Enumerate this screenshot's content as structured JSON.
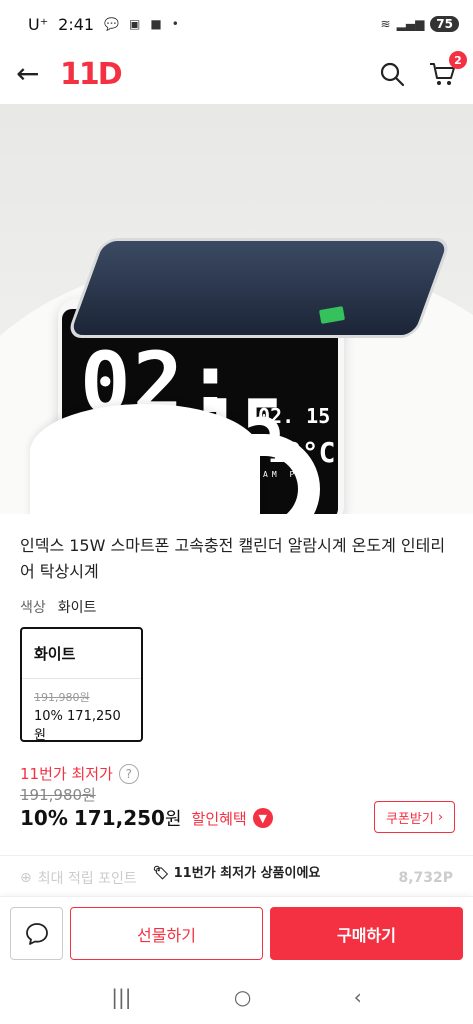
{
  "status_bar": {
    "carrier": "U⁺",
    "time": "2:41",
    "battery": "75"
  },
  "header": {
    "logo": "11D",
    "cart_count": "2"
  },
  "product": {
    "title": "인덱스 15W 스마트폰 고속충전 캘린더 알람시계 온도계 인테리어 탁상시계",
    "option_key": "색상",
    "option_value": "화이트",
    "option_card": {
      "name": "화이트",
      "original_price": "191,980원",
      "sale": "10% 171,250원"
    },
    "image_display": {
      "time_hours": "02:",
      "time_minutes": "15",
      "date": "02. 15",
      "temp": "19°C",
      "ampm": "AM PM"
    }
  },
  "pricing": {
    "lowest_label": "11번가 최저가",
    "original_price": "191,980원",
    "discount_pct": "10%",
    "price": "171,250",
    "currency": "원",
    "benefit_label": "할인혜택",
    "coupon_label": "쿠폰받기"
  },
  "points": {
    "label": "최대 적립 포인트",
    "value": "8,732P"
  },
  "toast": "11번가 최저가 상품이에요",
  "actions": {
    "gift_label": "선물하기",
    "buy_label": "구매하기"
  },
  "colors": {
    "brand": "#f43142"
  }
}
